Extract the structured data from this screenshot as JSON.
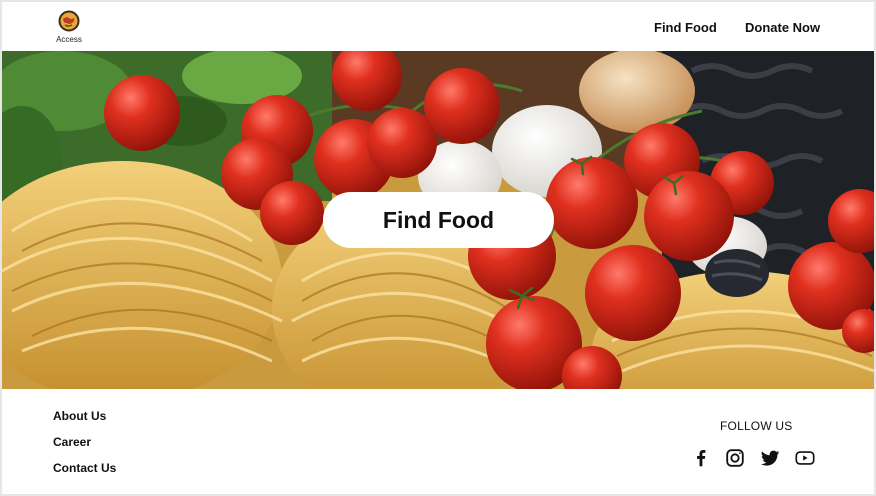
{
  "header": {
    "logo_text": "Access",
    "logo_icon": "globe-icon",
    "nav": [
      {
        "label": "Find Food"
      },
      {
        "label": "Donate Now"
      }
    ]
  },
  "hero": {
    "image": "pasta-tomatoes-food-photo",
    "cta_label": "Find Food"
  },
  "footer": {
    "links": [
      {
        "label": "About Us"
      },
      {
        "label": "Career"
      },
      {
        "label": "Contact Us"
      }
    ],
    "follow_label": "FOLLOW US",
    "social": [
      "facebook-icon",
      "instagram-icon",
      "twitter-icon",
      "youtube-icon"
    ]
  },
  "colors": {
    "background": "#ffffff",
    "tomato": "#d42b1e",
    "pasta": "#e0b04c",
    "text": "#111111"
  }
}
